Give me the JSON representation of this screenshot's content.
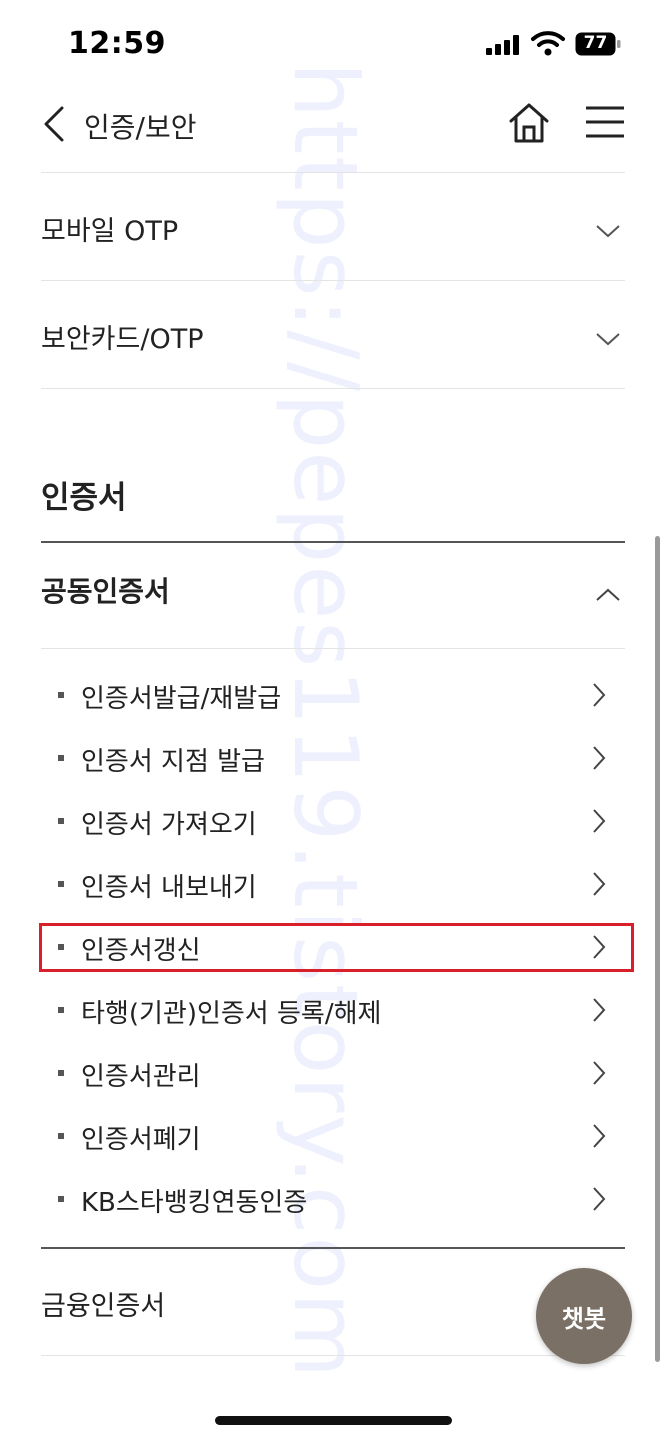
{
  "status_bar": {
    "time": "12:59",
    "battery": "77"
  },
  "header": {
    "title": "인증/보안",
    "icons": [
      "back-icon",
      "home-icon",
      "hamburger-menu-icon"
    ]
  },
  "watermark": "https://pepes119.tistory.com",
  "top_items": [
    {
      "label": "모바일 OTP"
    },
    {
      "label": "보안카드/OTP"
    }
  ],
  "section": {
    "title": "인증서",
    "group": {
      "title": "공동인증서",
      "items": [
        {
          "label": "인증서발급/재발급"
        },
        {
          "label": "인증서 지점 발급"
        },
        {
          "label": "인증서 가져오기"
        },
        {
          "label": "인증서 내보내기"
        },
        {
          "label": "인증서갱신"
        },
        {
          "label": "타행(기관)인증서 등록/해제"
        },
        {
          "label": "인증서관리"
        },
        {
          "label": "인증서폐기"
        },
        {
          "label": "KB스타뱅킹연동인증"
        }
      ]
    },
    "next_group": {
      "title": "금융인증서"
    }
  },
  "chatbot": {
    "label": "챗봇"
  },
  "colors": {
    "highlight": "#d9202a",
    "chatbot": "#7a7065",
    "watermark": "#eef0fd"
  }
}
